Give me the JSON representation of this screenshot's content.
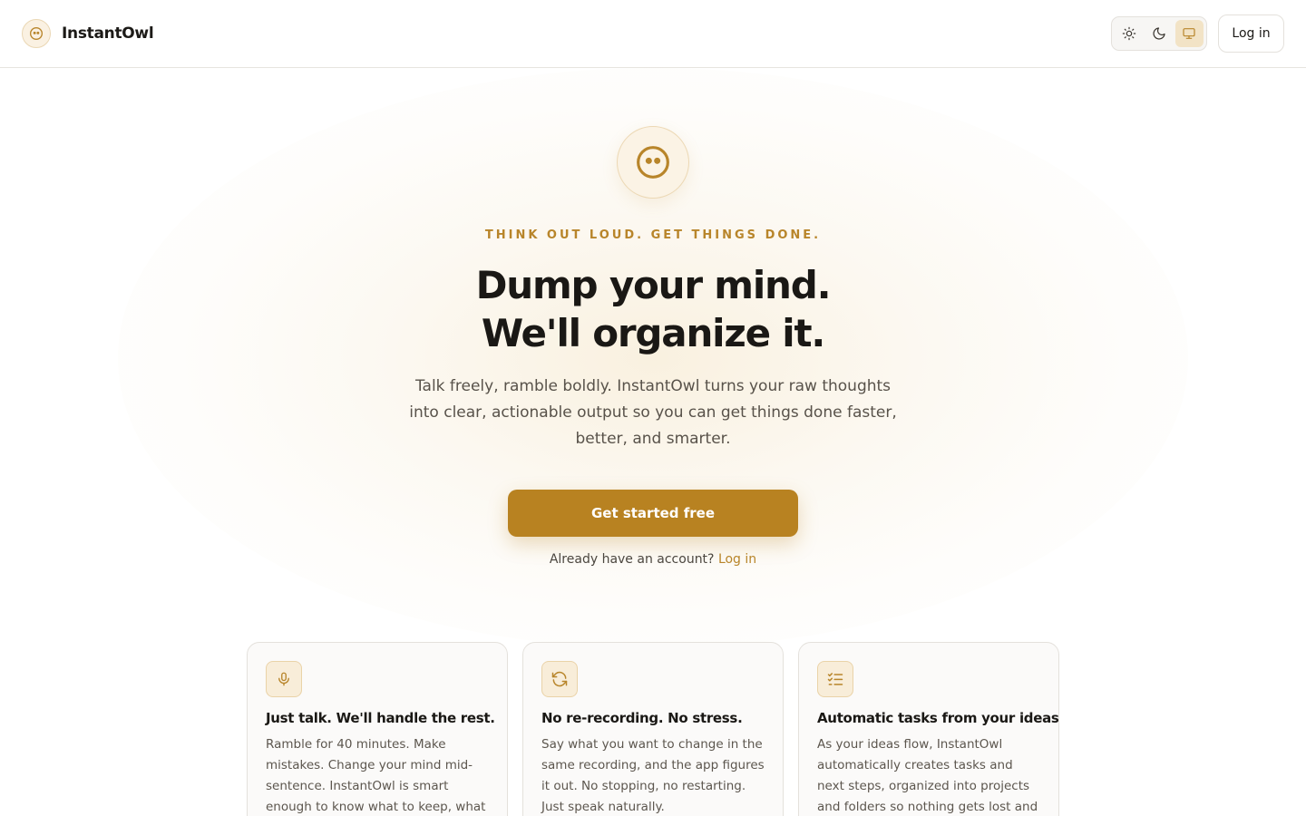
{
  "header": {
    "brand_name": "InstantOwl",
    "brand_icon": "owl-face-icon",
    "theme_options": [
      {
        "name": "light",
        "icon": "sun-icon",
        "active": false
      },
      {
        "name": "dark",
        "icon": "moon-icon",
        "active": false
      },
      {
        "name": "system",
        "icon": "monitor-icon",
        "active": true
      }
    ],
    "login_label": "Log in"
  },
  "hero": {
    "icon": "owl-face-icon",
    "eyebrow": "THINK OUT LOUD. GET THINGS DONE.",
    "headline_line1": "Dump your mind.",
    "headline_line2": "We'll organize it.",
    "subtext": "Talk freely, ramble boldly. InstantOwl turns your raw thoughts into clear, actionable output so you can get things done faster, better, and smarter.",
    "cta_label": "Get started free",
    "account_prompt": "Already have an account?",
    "account_link": "Log in"
  },
  "features": [
    {
      "icon": "microphone-icon",
      "title": "Just talk. We'll handle the rest.",
      "body": "Ramble for 40 minutes. Make mistakes. Change your mind mid-sentence. InstantOwl is smart enough to know what to keep, what to cut,"
    },
    {
      "icon": "refresh-icon",
      "title": "No re-recording. No stress.",
      "body": "Say what you want to change in the same recording, and the app figures it out. No stopping, no restarting. Just speak naturally."
    },
    {
      "icon": "checklist-icon",
      "title": "Automatic tasks from your ideas",
      "body": "As your ideas flow, InstantOwl automatically creates tasks and next steps, organized into projects and folders so nothing gets lost and"
    }
  ],
  "colors": {
    "accent": "#b88221",
    "accent_text": "#b8852a",
    "heading": "#1a1815",
    "body_text": "#58524a"
  }
}
